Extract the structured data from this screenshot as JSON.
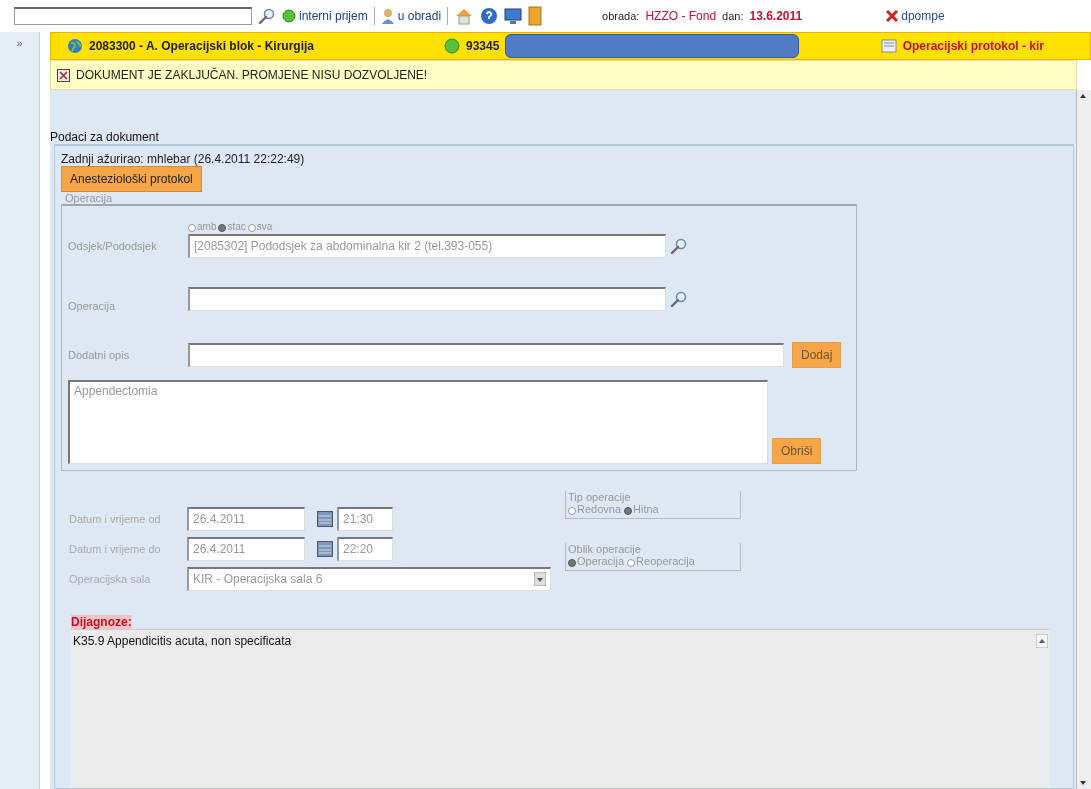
{
  "toolbar": {
    "links": [
      {
        "kind": "intake",
        "label": "interni prijem"
      },
      {
        "kind": "person",
        "label": "u obradi"
      }
    ],
    "obrada_label": "obrada:",
    "obrada_value": "HZZO - Fond",
    "dan_label": "dan:",
    "dan_value": "13.6.2011",
    "user": "dpompe"
  },
  "sidebar_toggle": "»",
  "header": {
    "department": "2083300 - A. Operacijski blok - Kirurgija",
    "patient_id": "93345",
    "document": "Operacijski protokol - kir"
  },
  "notice": "DOKUMENT JE ZAKLJUČAN. PROMJENE NISU DOZVOLJENE!",
  "document": {
    "legend": "Podaci za dokument",
    "last_updated": "Zadnji ažurirao: mhlebar (26.4.2011 22:22:49)",
    "button": "Anesteziološki protokol",
    "operation": {
      "legend": "Operacija",
      "disabled": true,
      "scope": [
        {
          "label": "amb",
          "selected": false
        },
        {
          "label": "stac",
          "selected": true
        },
        {
          "label": "sva",
          "selected": false
        }
      ],
      "department_label": "Odsjek/Pododsjek",
      "department_value": "[2085302] Pododsjek za abdominalna kir 2 (tel.393-055)",
      "operation_label": "Operacija",
      "description_label": "Dodatni opis",
      "add_button": "Dodaj",
      "text": "Appendectomia",
      "delete_button": "Obriši"
    },
    "schedule": {
      "disabled": true,
      "from_label": "Datum i vrijeme od",
      "from_date": "26.4.2011",
      "from_time": "21:30",
      "to_label": "Datum i vrijeme do",
      "to_date": "26.4.2011",
      "to_time": "22:20",
      "room_label": "Operacijska sala",
      "room_value": "KIR - Operacijska sala 6"
    },
    "type": {
      "legend": "Tip operacije",
      "options": [
        {
          "label": "Redovna",
          "selected": false
        },
        {
          "label": "Hitna",
          "selected": true
        }
      ]
    },
    "form": {
      "legend": "Oblik operacije",
      "options": [
        {
          "label": "Operacija",
          "selected": true
        },
        {
          "label": "Reoperacija",
          "selected": false
        }
      ]
    },
    "diagnoses_label": "Dijagnoze:",
    "diagnoses": [
      "K35.9 Appendicitis acuta, non specificata"
    ]
  }
}
